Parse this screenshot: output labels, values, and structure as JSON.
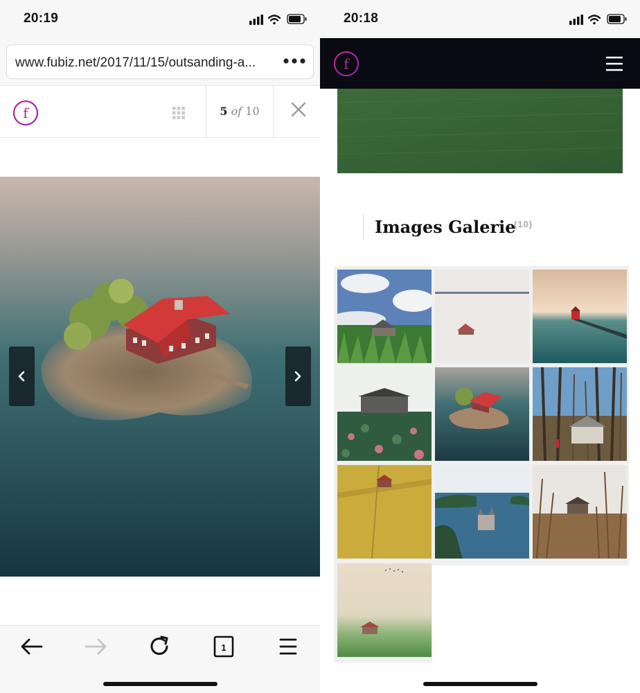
{
  "left": {
    "status": {
      "time": "20:19"
    },
    "browser": {
      "url": "www.fubiz.net/2017/11/15/outsanding-a..."
    },
    "lightbox": {
      "logo_letter": "f",
      "counter": {
        "current": "5",
        "of": "of",
        "total": "10"
      }
    }
  },
  "right": {
    "status": {
      "time": "20:18"
    },
    "site": {
      "logo_letter": "f"
    },
    "gallery": {
      "title": "Images Galerie",
      "count": "(10)",
      "thumbnails": [
        "thumb-cabin-corn-field",
        "thumb-snow-house",
        "thumb-lighthouse-pier",
        "thumb-cabin-flowers",
        "thumb-island-house",
        "thumb-forest-cabin",
        "thumb-wheat-field-house",
        "thumb-lake-castle",
        "thumb-dry-grass-cabin",
        "thumb-foggy-green-house"
      ]
    }
  },
  "colors": {
    "brand_gradient_start": "#a51c8e",
    "brand_gradient_end": "#e0407a",
    "site_header": "#0a0a12"
  }
}
